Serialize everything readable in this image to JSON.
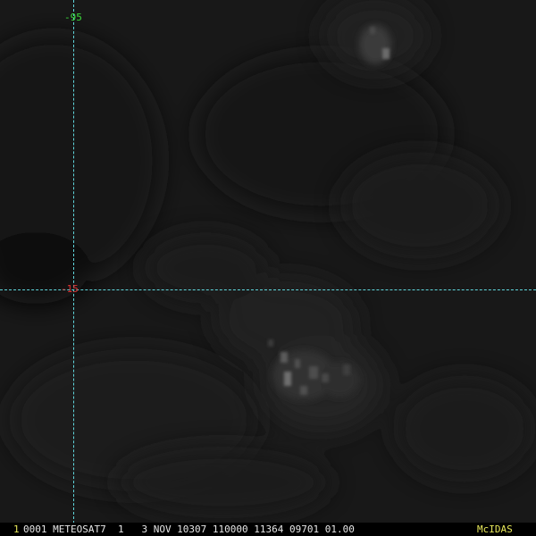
{
  "overlay": {
    "longitude_label": "-95",
    "latitude_label": "-15",
    "longitude_color": "#3cdc3c",
    "latitude_color": "#e03030",
    "grid_color": "#5fd6dc"
  },
  "status_bar": {
    "frame_number": "1",
    "text": "0001 METEOSAT7  1   3 NOV 10307 110000 11364 09701 01.00",
    "brand": "McIDAS",
    "highlight_color": "#e8e85a",
    "text_color": "#e6e6e6"
  }
}
